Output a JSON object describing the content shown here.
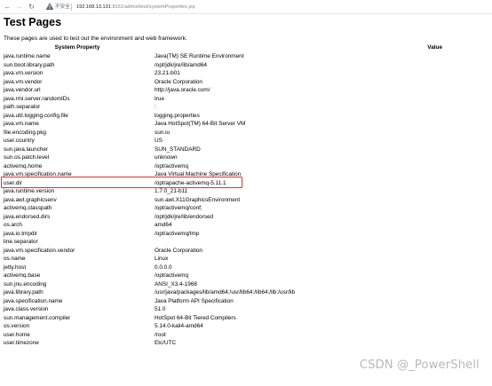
{
  "browser": {
    "insecure_label": "不安全",
    "url_host": "192.168.13.131",
    "url_rest": ":8161/admin/test/systemProperties.jsp"
  },
  "page": {
    "title": "Test Pages",
    "intro": "These pages are used to test out the environment and web framework."
  },
  "table": {
    "headers": [
      "System Property",
      "Value"
    ],
    "rows": [
      [
        "java.runtime.name",
        "Java(TM) SE Runtime Environment"
      ],
      [
        "sun.boot.library.path",
        "/opt/jdk/jre/lib/amd64"
      ],
      [
        "java.vm.version",
        "23.21-b01"
      ],
      [
        "java.vm.vendor",
        "Oracle Corporation"
      ],
      [
        "java.vendor.url",
        "http://java.oracle.com/"
      ],
      [
        "java.rmi.server.randomIDs",
        "true"
      ],
      [
        "path.separator",
        ":"
      ],
      [
        "java.util.logging.config.file",
        "logging.properties"
      ],
      [
        "java.vm.name",
        "Java HotSpot(TM) 64-Bit Server VM"
      ],
      [
        "file.encoding.pkg",
        "sun.io"
      ],
      [
        "user.country",
        "US"
      ],
      [
        "sun.java.launcher",
        "SUN_STANDARD"
      ],
      [
        "sun.os.patch.level",
        "unknown"
      ],
      [
        "activemq.home",
        "/opt/activemq"
      ],
      [
        "java.vm.specification.name",
        "Java Virtual Machine Specification"
      ],
      [
        "user.dir",
        "/opt/apache-activemq-5.11.1"
      ],
      [
        "java.runtime.version",
        "1.7.0_21-b11"
      ],
      [
        "java.awt.graphicsenv",
        "sun.awt.X11GraphicsEnvironment"
      ],
      [
        "activemq.classpath",
        "/opt/activemq/conf;"
      ],
      [
        "java.endorsed.dirs",
        "/opt/jdk/jre/lib/endorsed"
      ],
      [
        "os.arch",
        "amd64"
      ],
      [
        "java.io.tmpdir",
        "/opt/activemq/tmp"
      ],
      [
        "line.separator",
        ""
      ],
      [
        "java.vm.specification.vendor",
        "Oracle Corporation"
      ],
      [
        "os.name",
        "Linux"
      ],
      [
        "jetty.host",
        "0.0.0.0"
      ],
      [
        "activemq.base",
        "/opt/activemq"
      ],
      [
        "sun.jnu.encoding",
        "ANSI_X3.4-1968"
      ],
      [
        "java.library.path",
        "/usr/java/packages/lib/amd64:/usr/lib64:/lib64:/lib:/usr/lib"
      ],
      [
        "java.specification.name",
        "Java Platform API Specification"
      ],
      [
        "java.class.version",
        "51.0"
      ],
      [
        "sun.management.compiler",
        "HotSpot 64-Bit Tiered Compilers"
      ],
      [
        "os.version",
        "5.14.0-kali4-amd64"
      ],
      [
        "user.home",
        "/root"
      ],
      [
        "user.timezone",
        "Etc/UTC"
      ]
    ]
  },
  "watermark": "CSDN @_PowerShell",
  "colors": {
    "highlight": "#d9342b"
  }
}
